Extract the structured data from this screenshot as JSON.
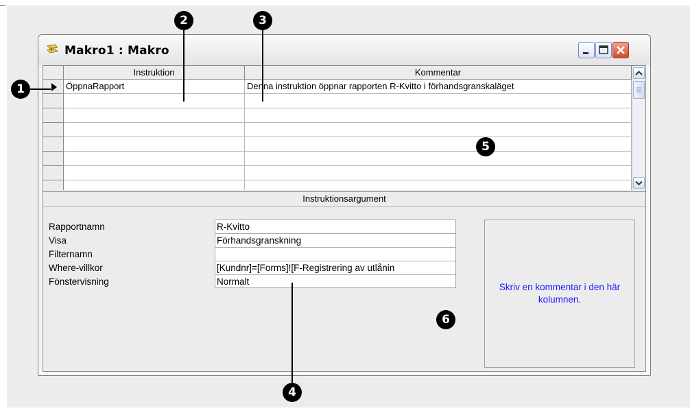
{
  "window": {
    "title": "Makro1 : Makro",
    "icon": "macro-icon"
  },
  "grid": {
    "columns": [
      "Instruktion",
      "Kommentar"
    ],
    "rows": [
      {
        "instruction": "ÖppnaRapport",
        "comment": "Denna instruktion öppnar rapporten R-Kvitto i förhandsgranskaläget"
      },
      {
        "instruction": "",
        "comment": ""
      },
      {
        "instruction": "",
        "comment": ""
      },
      {
        "instruction": "",
        "comment": ""
      },
      {
        "instruction": "",
        "comment": ""
      },
      {
        "instruction": "",
        "comment": ""
      },
      {
        "instruction": "",
        "comment": ""
      },
      {
        "instruction": "",
        "comment": ""
      }
    ]
  },
  "arguments": {
    "header": "Instruktionsargument",
    "items": [
      {
        "label": "Rapportnamn",
        "value": "R-Kvitto"
      },
      {
        "label": "Visa",
        "value": "Förhandsgranskning"
      },
      {
        "label": "Filternamn",
        "value": ""
      },
      {
        "label": "Where-villkor",
        "value": "[Kundnr]=[Forms]![F-Registrering av utlånin"
      },
      {
        "label": "Fönstervisning",
        "value": "Normalt"
      }
    ],
    "hint": "Skriv en kommentar i den här kolumnen."
  },
  "callouts": [
    "1",
    "2",
    "3",
    "4",
    "5",
    "6"
  ]
}
